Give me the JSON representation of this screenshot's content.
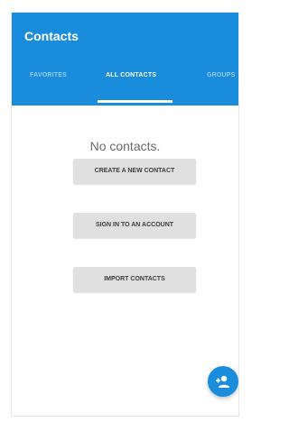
{
  "app": {
    "title": "Contacts"
  },
  "tabs": [
    {
      "label": "FAVORITES",
      "active": false
    },
    {
      "label": "ALL CONTACTS",
      "active": true
    },
    {
      "label": "GROUPS",
      "active": false
    }
  ],
  "content": {
    "empty_message": "No contacts."
  },
  "actions": {
    "create_label": "CREATE A NEW CONTACT",
    "signin_label": "SIGN IN TO AN ACCOUNT",
    "import_label": "IMPORT CONTACTS"
  },
  "fab": {
    "icon": "add-contact-icon"
  },
  "colors": {
    "accent": "#1a8cdc",
    "button_bg": "#e0e0e0",
    "empty_text": "#6b6b6b"
  }
}
